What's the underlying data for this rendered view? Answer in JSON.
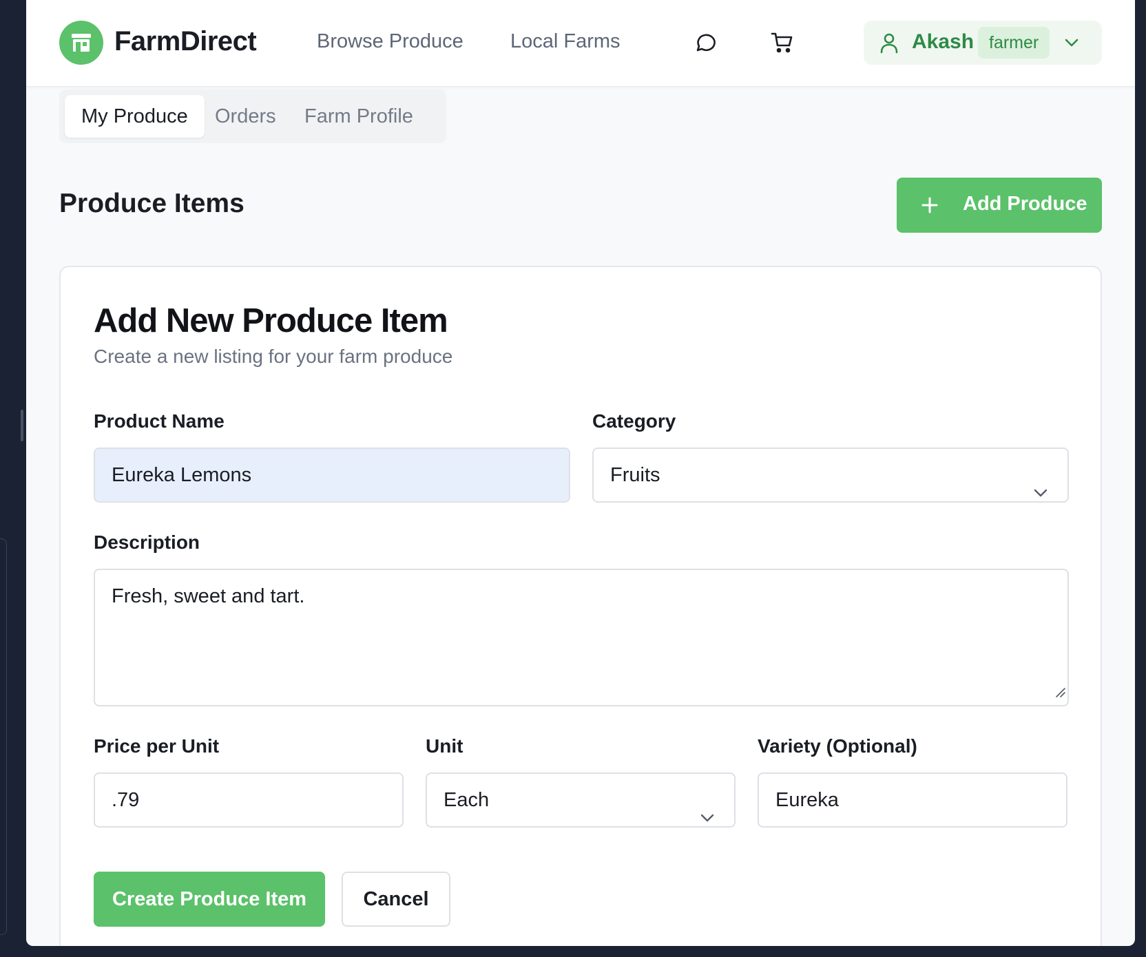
{
  "header": {
    "brand": "FarmDirect",
    "nav": [
      {
        "label": "Browse Produce"
      },
      {
        "label": "Local Farms"
      }
    ],
    "icons": [
      "message-icon",
      "cart-icon"
    ],
    "user": {
      "name": "Akash",
      "role": "farmer"
    }
  },
  "tabs": [
    {
      "label": "My Produce",
      "active": true
    },
    {
      "label": "Orders",
      "active": false
    },
    {
      "label": "Farm Profile",
      "active": false
    }
  ],
  "section": {
    "title": "Produce Items",
    "add_button": "Add Produce"
  },
  "form": {
    "title": "Add New Produce Item",
    "subtitle": "Create a new listing for your farm produce",
    "product_name": {
      "label": "Product Name",
      "value": "Eureka Lemons"
    },
    "category": {
      "label": "Category",
      "value": "Fruits"
    },
    "description": {
      "label": "Description",
      "value": "Fresh, sweet and tart."
    },
    "price": {
      "label": "Price per Unit",
      "value": ".79"
    },
    "unit": {
      "label": "Unit",
      "value": "Each"
    },
    "variety": {
      "label": "Variety (Optional)",
      "value": "Eureka"
    },
    "submit_label": "Create Produce Item",
    "cancel_label": "Cancel"
  },
  "colors": {
    "accent": "#5bc16a",
    "accent_dark": "#2f8a45",
    "autofill_bg": "#e8effc"
  }
}
